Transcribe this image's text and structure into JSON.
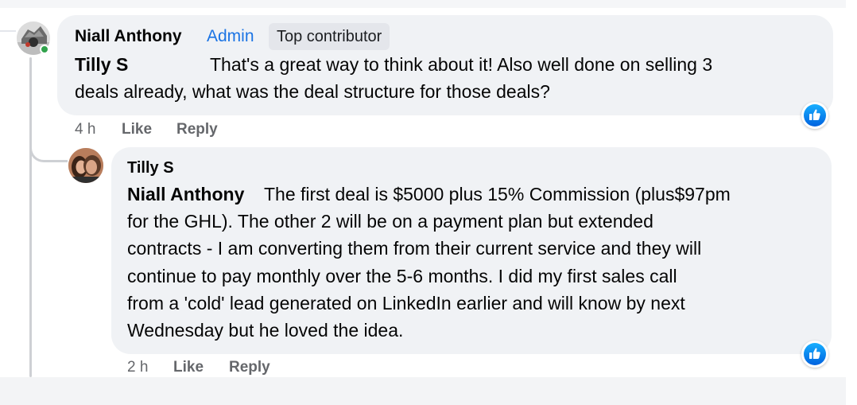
{
  "comment": {
    "author": "Niall Anthony",
    "admin_badge": "Admin",
    "contributor_badge": "Top contributor",
    "mention": "Tilly S",
    "line1": "That's a great way to think about it! Also well done on selling 3",
    "line2": "deals already, what was the deal structure for those deals?",
    "timestamp": "4 h",
    "like_label": "Like",
    "reply_label": "Reply",
    "reaction_icon": "like-reaction-icon"
  },
  "reply": {
    "author": "Tilly S",
    "mention": "Niall Anthony",
    "line1": "The first deal is $5000 plus 15% Commission (plus$97pm",
    "line2": "for the GHL). The other 2 will be on a payment plan but extended",
    "line3": "contracts - I am converting them from their current service and they will",
    "line4": "continue to pay monthly over the 5-6 months. I did my first sales call",
    "line5": "from a 'cold' lead generated on LinkedIn earlier and will know by next",
    "line6": "Wednesday but he loved the idea.",
    "timestamp": "2 h",
    "like_label": "Like",
    "reply_label": "Reply",
    "reaction_icon": "like-reaction-icon"
  },
  "colors": {
    "bubble": "#f0f2f5",
    "admin_blue": "#1b74e4",
    "meta_gray": "#65676b",
    "like_blue": "#0866ff",
    "online_green": "#31a24c"
  }
}
